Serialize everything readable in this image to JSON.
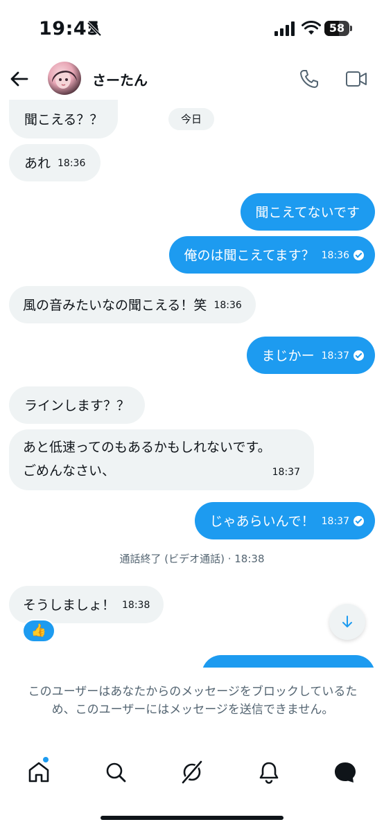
{
  "status_bar": {
    "time": "19:45",
    "battery": "58",
    "battery_level": 0.58
  },
  "header": {
    "contact_name": "さーたん"
  },
  "chat": {
    "date_label": "今日",
    "messages": [
      {
        "dir": "in",
        "text": "聞こえる？？",
        "time": ""
      },
      {
        "dir": "in",
        "text": "あれ",
        "time": "18:36"
      },
      {
        "dir": "out",
        "text": "聞こえてないです",
        "time": ""
      },
      {
        "dir": "out",
        "text": "俺のは聞こえてます？",
        "time": "18:36"
      },
      {
        "dir": "in",
        "text": "風の音みたいなの聞こえる！笑",
        "time": "18:36"
      },
      {
        "dir": "out",
        "text": "まじかー",
        "time": "18:37"
      },
      {
        "dir": "in",
        "text": "ラインします？？",
        "time": ""
      },
      {
        "dir": "in",
        "text_line1": "あと低速ってのもあるかもしれないです。",
        "text_line2": "ごめんなさい、",
        "time": "18:37"
      },
      {
        "dir": "out",
        "text": "じゃあらいんで！",
        "time": "18:37"
      },
      {
        "dir": "in",
        "text": "そうしましょ！",
        "time": "18:38"
      }
    ],
    "call_note": "通話終了 (ビデオ通話) · 18:38",
    "reaction": "👍"
  },
  "blocked_notice": "このユーザーはあなたからのメッセージをブロックしているため、このユーザーにはメッセージを送信できません。",
  "nav": {
    "items": [
      "home-icon",
      "search-icon",
      "grok-icon",
      "bell-icon",
      "messages-icon"
    ]
  },
  "colors": {
    "accent": "#1d9bf0",
    "incoming_bg": "#eff3f4",
    "text": "#0f1419",
    "muted": "#536471"
  }
}
